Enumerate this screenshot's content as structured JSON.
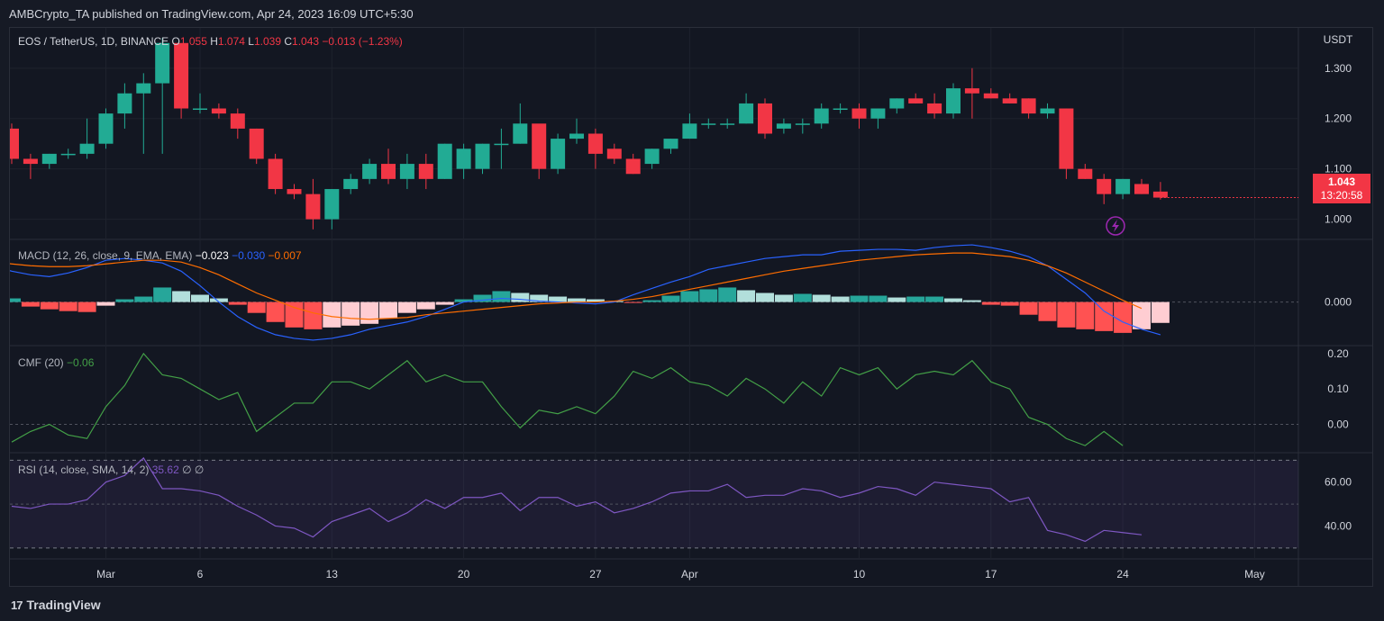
{
  "publisher": "AMBCrypto_TA published on TradingView.com, Apr 24, 2023 16:09 UTC+5:30",
  "footer": {
    "logo_text": "TradingView"
  },
  "main_legend": {
    "symbol": "EOS / TetherUS, 1D, BINANCE",
    "o_label": "O",
    "o": "1.055",
    "h_label": "H",
    "h": "1.074",
    "l_label": "L",
    "l": "1.039",
    "c_label": "C",
    "c": "1.043",
    "change": "−0.013 (−1.23%)"
  },
  "macd_legend": {
    "name": "MACD (12, 26, close, 9, EMA, EMA)",
    "hist": "−0.023",
    "macd": "−0.030",
    "signal": "−0.007"
  },
  "cmf_legend": {
    "name": "CMF (20)",
    "value": "−0.06"
  },
  "rsi_legend": {
    "name": "RSI (14, close, SMA, 14, 2)",
    "value": "35.62",
    "ext1": "∅",
    "ext2": "∅"
  },
  "price_badge": {
    "price": "1.043",
    "countdown": "13:20:58"
  },
  "colors": {
    "up": "#22ab94",
    "down": "#f23645",
    "macd": "#2962ff",
    "signal": "#ff6d00",
    "cmf": "#43a047",
    "rsi": "#7e57c2"
  },
  "chart_data": {
    "type": "candlestick",
    "y_axis_unit": "USDT",
    "x_ticks": [
      "Mar",
      "6",
      "13",
      "20",
      "27",
      "Apr",
      "10",
      "17",
      "24",
      "May"
    ],
    "price_ticks": [
      "1.300",
      "1.200",
      "1.100",
      "1.000"
    ],
    "candles": [
      [
        1.18,
        1.19,
        1.11,
        1.12
      ],
      [
        1.12,
        1.13,
        1.08,
        1.11
      ],
      [
        1.11,
        1.13,
        1.1,
        1.13
      ],
      [
        1.13,
        1.14,
        1.12,
        1.13
      ],
      [
        1.13,
        1.2,
        1.12,
        1.15
      ],
      [
        1.15,
        1.22,
        1.14,
        1.21
      ],
      [
        1.21,
        1.27,
        1.18,
        1.25
      ],
      [
        1.25,
        1.29,
        1.13,
        1.27
      ],
      [
        1.27,
        1.36,
        1.13,
        1.35
      ],
      [
        1.35,
        1.34,
        1.2,
        1.22
      ],
      [
        1.22,
        1.25,
        1.21,
        1.22
      ],
      [
        1.22,
        1.23,
        1.2,
        1.21
      ],
      [
        1.21,
        1.22,
        1.16,
        1.18
      ],
      [
        1.18,
        1.18,
        1.11,
        1.12
      ],
      [
        1.12,
        1.13,
        1.05,
        1.06
      ],
      [
        1.06,
        1.07,
        1.04,
        1.05
      ],
      [
        1.05,
        1.08,
        0.98,
        1.0
      ],
      [
        1.0,
        1.06,
        0.98,
        1.06
      ],
      [
        1.06,
        1.09,
        1.05,
        1.08
      ],
      [
        1.08,
        1.12,
        1.07,
        1.11
      ],
      [
        1.11,
        1.14,
        1.07,
        1.08
      ],
      [
        1.08,
        1.13,
        1.06,
        1.11
      ],
      [
        1.11,
        1.13,
        1.06,
        1.08
      ],
      [
        1.08,
        1.15,
        1.08,
        1.15
      ],
      [
        1.1,
        1.15,
        1.08,
        1.14
      ],
      [
        1.1,
        1.15,
        1.09,
        1.15
      ],
      [
        1.15,
        1.18,
        1.1,
        1.15
      ],
      [
        1.15,
        1.23,
        1.15,
        1.19
      ],
      [
        1.19,
        1.18,
        1.08,
        1.1
      ],
      [
        1.1,
        1.17,
        1.09,
        1.16
      ],
      [
        1.16,
        1.2,
        1.15,
        1.17
      ],
      [
        1.17,
        1.18,
        1.1,
        1.13
      ],
      [
        1.14,
        1.15,
        1.11,
        1.12
      ],
      [
        1.12,
        1.13,
        1.09,
        1.09
      ],
      [
        1.11,
        1.14,
        1.1,
        1.14
      ],
      [
        1.14,
        1.16,
        1.13,
        1.16
      ],
      [
        1.16,
        1.21,
        1.16,
        1.19
      ],
      [
        1.19,
        1.2,
        1.18,
        1.19
      ],
      [
        1.19,
        1.2,
        1.18,
        1.19
      ],
      [
        1.19,
        1.25,
        1.19,
        1.23
      ],
      [
        1.23,
        1.24,
        1.16,
        1.17
      ],
      [
        1.18,
        1.2,
        1.17,
        1.19
      ],
      [
        1.19,
        1.2,
        1.17,
        1.19
      ],
      [
        1.19,
        1.23,
        1.18,
        1.22
      ],
      [
        1.22,
        1.23,
        1.21,
        1.22
      ],
      [
        1.22,
        1.23,
        1.18,
        1.2
      ],
      [
        1.2,
        1.22,
        1.18,
        1.22
      ],
      [
        1.22,
        1.24,
        1.21,
        1.24
      ],
      [
        1.24,
        1.25,
        1.23,
        1.23
      ],
      [
        1.23,
        1.25,
        1.2,
        1.21
      ],
      [
        1.21,
        1.27,
        1.2,
        1.26
      ],
      [
        1.26,
        1.3,
        1.2,
        1.25
      ],
      [
        1.25,
        1.26,
        1.24,
        1.24
      ],
      [
        1.24,
        1.25,
        1.23,
        1.23
      ],
      [
        1.24,
        1.24,
        1.2,
        1.21
      ],
      [
        1.21,
        1.23,
        1.2,
        1.22
      ],
      [
        1.22,
        1.22,
        1.08,
        1.1
      ],
      [
        1.1,
        1.11,
        1.08,
        1.08
      ],
      [
        1.08,
        1.09,
        1.03,
        1.05
      ],
      [
        1.05,
        1.08,
        1.04,
        1.08
      ],
      [
        1.07,
        1.08,
        1.05,
        1.05
      ],
      [
        1.055,
        1.074,
        1.039,
        1.043
      ]
    ],
    "macd": {
      "zero_label": "0.000",
      "histogram": [
        0.004,
        -0.005,
        -0.008,
        -0.01,
        -0.011,
        -0.004,
        0.003,
        0.006,
        0.016,
        0.012,
        0.008,
        0.004,
        -0.003,
        -0.012,
        -0.022,
        -0.028,
        -0.03,
        -0.028,
        -0.026,
        -0.024,
        -0.018,
        -0.012,
        -0.008,
        -0.003,
        0.003,
        0.008,
        0.012,
        0.01,
        0.008,
        0.006,
        0.004,
        0.003,
        0.001,
        -0.001,
        0.002,
        0.007,
        0.012,
        0.014,
        0.016,
        0.013,
        0.01,
        0.008,
        0.009,
        0.008,
        0.006,
        0.007,
        0.007,
        0.005,
        0.006,
        0.006,
        0.004,
        0.002,
        -0.003,
        -0.004,
        -0.014,
        -0.021,
        -0.028,
        -0.03,
        -0.032,
        -0.034,
        -0.03,
        -0.023
      ],
      "macd_line": [
        0.045,
        0.04,
        0.034,
        0.03,
        0.028,
        0.032,
        0.038,
        0.046,
        0.048,
        0.046,
        0.043,
        0.034,
        0.018,
        0.0,
        -0.016,
        -0.028,
        -0.036,
        -0.04,
        -0.042,
        -0.04,
        -0.036,
        -0.03,
        -0.026,
        -0.022,
        -0.016,
        -0.008,
        0.0,
        0.002,
        0.004,
        0.003,
        0.001,
        0.0,
        -0.001,
        -0.002,
        0.0,
        0.008,
        0.015,
        0.022,
        0.028,
        0.036,
        0.04,
        0.044,
        0.048,
        0.05,
        0.052,
        0.052,
        0.056,
        0.057,
        0.058,
        0.058,
        0.057,
        0.06,
        0.062,
        0.063,
        0.06,
        0.056,
        0.05,
        0.04,
        0.025,
        0.01,
        -0.01,
        -0.022,
        -0.03,
        -0.036
      ],
      "signal_line": [
        0.045,
        0.044,
        0.042,
        0.04,
        0.039,
        0.039,
        0.04,
        0.042,
        0.044,
        0.046,
        0.046,
        0.044,
        0.038,
        0.03,
        0.02,
        0.01,
        0.002,
        -0.006,
        -0.012,
        -0.016,
        -0.018,
        -0.019,
        -0.018,
        -0.017,
        -0.014,
        -0.012,
        -0.01,
        -0.008,
        -0.006,
        -0.004,
        -0.002,
        -0.001,
        0.0,
        0.0,
        0.001,
        0.003,
        0.006,
        0.01,
        0.014,
        0.018,
        0.022,
        0.026,
        0.03,
        0.034,
        0.037,
        0.04,
        0.043,
        0.046,
        0.048,
        0.05,
        0.052,
        0.053,
        0.054,
        0.054,
        0.052,
        0.05,
        0.046,
        0.04,
        0.032,
        0.022,
        0.012,
        0.002,
        -0.007
      ]
    },
    "cmf": {
      "ticks": [
        "0.20",
        "0.10",
        "0.00"
      ],
      "values": [
        -0.05,
        -0.02,
        0.0,
        -0.03,
        -0.04,
        0.05,
        0.11,
        0.2,
        0.14,
        0.13,
        0.1,
        0.07,
        0.09,
        -0.02,
        0.02,
        0.06,
        0.06,
        0.12,
        0.12,
        0.1,
        0.14,
        0.18,
        0.12,
        0.14,
        0.12,
        0.12,
        0.05,
        -0.01,
        0.04,
        0.03,
        0.05,
        0.03,
        0.08,
        0.15,
        0.13,
        0.16,
        0.12,
        0.11,
        0.08,
        0.13,
        0.1,
        0.06,
        0.12,
        0.08,
        0.16,
        0.14,
        0.16,
        0.1,
        0.14,
        0.15,
        0.14,
        0.18,
        0.12,
        0.1,
        0.02,
        0.0,
        -0.04,
        -0.06,
        -0.02,
        -0.06
      ]
    },
    "rsi": {
      "ticks": [
        "60.00",
        "40.00"
      ],
      "upper_band": 70,
      "lower_band": 30,
      "mid": 50,
      "values": [
        49,
        48,
        50,
        50,
        52,
        60,
        63,
        71,
        57,
        57,
        56,
        54,
        49,
        45,
        40,
        39,
        35,
        42,
        45,
        48,
        42,
        46,
        52,
        48,
        53,
        53,
        55,
        47,
        53,
        53,
        49,
        51,
        46,
        48,
        51,
        55,
        56,
        56,
        59,
        53,
        54,
        54,
        57,
        56,
        53,
        55,
        58,
        57,
        54,
        60,
        59,
        58,
        57,
        51,
        53,
        38,
        36,
        33,
        38,
        37,
        36
      ]
    }
  }
}
